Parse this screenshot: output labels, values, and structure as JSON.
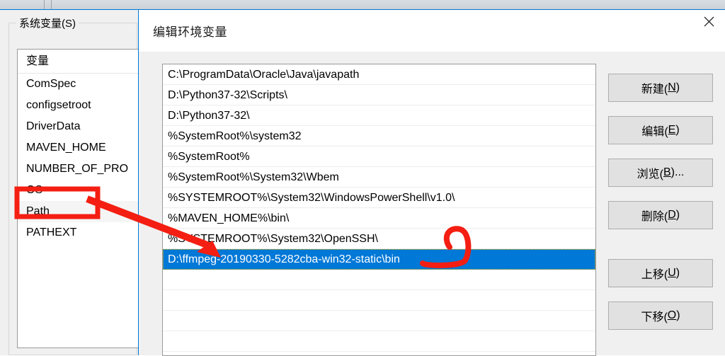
{
  "background_window": {
    "groupbox_title": "系统变量(S)",
    "variable_list": {
      "column_header": "变量",
      "rows": [
        "ComSpec",
        "configsetroot",
        "DriverData",
        "MAVEN_HOME",
        "NUMBER_OF_PRO",
        "OS",
        "Path",
        "PATHEXT"
      ],
      "selected": "Path"
    }
  },
  "dialog": {
    "title": "编辑环境变量",
    "close_icon": "close-icon",
    "path_entries": [
      "C:\\ProgramData\\Oracle\\Java\\javapath",
      "D:\\Python37-32\\Scripts\\",
      "D:\\Python37-32\\",
      "%SystemRoot%\\system32",
      "%SystemRoot%",
      "%SystemRoot%\\System32\\Wbem",
      "%SYSTEMROOT%\\System32\\WindowsPowerShell\\v1.0\\",
      "%MAVEN_HOME%\\bin\\",
      "%SYSTEMROOT%\\System32\\OpenSSH\\",
      "D:\\ffmpeg-20190330-5282cba-win32-static\\bin"
    ],
    "selected_index": 9,
    "buttons": {
      "new": {
        "text": "新建(",
        "key": "N",
        "close": ")"
      },
      "edit": {
        "text": "编辑(",
        "key": "E",
        "close": ")"
      },
      "browse": {
        "text": "浏览(",
        "key": "B",
        "close": ")..."
      },
      "delete": {
        "text": "删除(",
        "key": "D",
        "close": ")"
      },
      "move_up": {
        "text": "上移(",
        "key": "U",
        "close": ")"
      },
      "move_down": {
        "text": "下移(",
        "key": "O",
        "close": ")"
      }
    }
  },
  "annotation": {
    "color": "#f41e12",
    "shapes": [
      "rectangle-around-path-variable",
      "arrow-to-selected-entry",
      "circle-around-bin-suffix"
    ]
  },
  "colors": {
    "selection_blue": "#0078d7",
    "dialog_border": "#0078d7",
    "dialog_body": "#f0f0f0",
    "button_face": "#e1e1e1",
    "annotation_red": "#f41e12"
  }
}
